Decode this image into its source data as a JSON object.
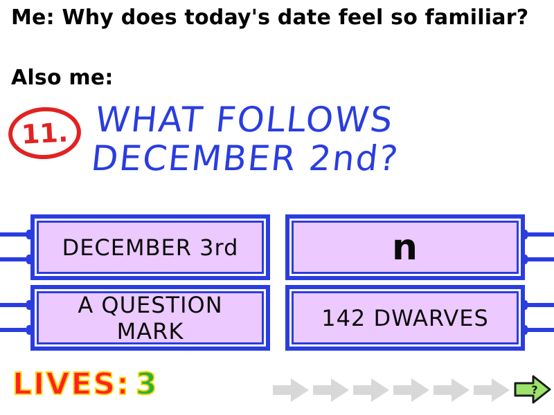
{
  "caption": {
    "line1": "Me: Why does today's date feel so familiar?",
    "line2": "Also me:"
  },
  "quiz": {
    "question_number": "11.",
    "question_lines": [
      "WHAT FOLLOWS",
      "DECEMBER 2nd?"
    ],
    "answers": [
      {
        "label": "DECEMBER 3rd"
      },
      {
        "label": "n"
      },
      {
        "label": "A QUESTION MARK"
      },
      {
        "label": "142 DWARVES"
      }
    ]
  },
  "hud": {
    "lives_label": "LIVES:",
    "lives_count": "3",
    "progress_arrows": 6,
    "next_symbol": "?"
  },
  "colors": {
    "ink_blue": "#2a3de0",
    "answer_fill": "#ecc9ff",
    "badge_red": "#e22222",
    "lives_red": "#ff2222",
    "lives_green": "#28b13d",
    "lives_outline": "#ffd400",
    "arrow_grey": "#d8d8d8",
    "next_green": "#9be36a"
  }
}
